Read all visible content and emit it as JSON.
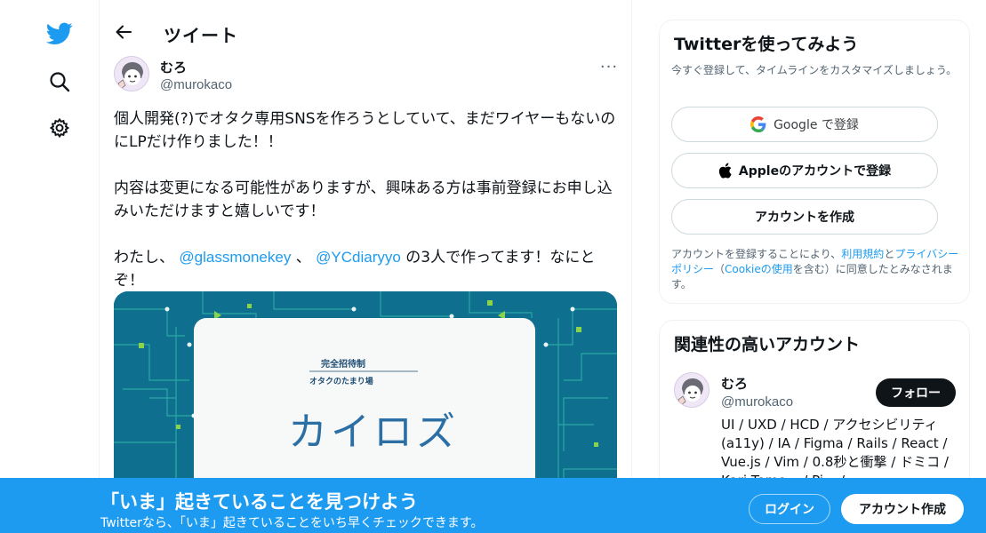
{
  "nav": {
    "icons": [
      "twitter-bird-icon",
      "search-icon",
      "gear-icon"
    ],
    "brand_color": "#1d9bf0"
  },
  "header": {
    "back_icon": "arrow-left-icon",
    "title": "ツイート"
  },
  "tweet": {
    "author_name": "むろ",
    "author_handle": "@murokaco",
    "more_icon": "ellipsis-icon",
    "more_glyph": "···",
    "para1": "個人開発(?)でオタク専用SNSを作ろうとしていて、まだワイヤーもないのにLPだけ作りました！！",
    "para2": "内容は変更になる可能性がありますが、興味ある方は事前登録にお申し込みいただけますと嬉しいです！",
    "para3_prefix": "わたし、 ",
    "mention1": "@glassmonekey",
    "para3_sep": " 、 ",
    "mention2": "@YCdiaryyo",
    "para3_suffix": " の3人で作ってます！なにとぞ！",
    "media": {
      "badge": "完全招待制",
      "subtitle": "オタクのたまり場",
      "logo": "カイロズ"
    }
  },
  "signup": {
    "title": "Twitterを使ってみよう",
    "description": "今すぐ登録して、タイムラインをカスタマイズしましょう。",
    "google_label": "Google で登録",
    "apple_label": "Appleのアカウントで登録",
    "create_label": "アカウントを作成",
    "legal_prefix": "アカウントを登録することにより、",
    "legal_terms": "利用規約",
    "legal_and": "と",
    "legal_privacy": "プライバシーポリシー",
    "legal_paren_open": "（",
    "legal_cookie": "Cookieの使用",
    "legal_paren_close": "を含む）に同意したとみなされます。"
  },
  "related": {
    "title": "関連性の高いアカウント",
    "name": "むろ",
    "handle": "@murokaco",
    "follow_label": "フォロー",
    "bio": "UI / UXD / HCD / アクセシビリティ (a11y) / IA / Figma / Rails / React / Vue.js / Vim / 0.8秒と衝撃 / ドミコ / Kari Tomo... / Pi... / ..."
  },
  "banner": {
    "title": "「いま」起きていることを見つけよう",
    "subtitle": "Twitterなら、「いま」起きていることをいち早くチェックできます。",
    "login_label": "ログイン",
    "signup_label": "アカウント作成"
  }
}
